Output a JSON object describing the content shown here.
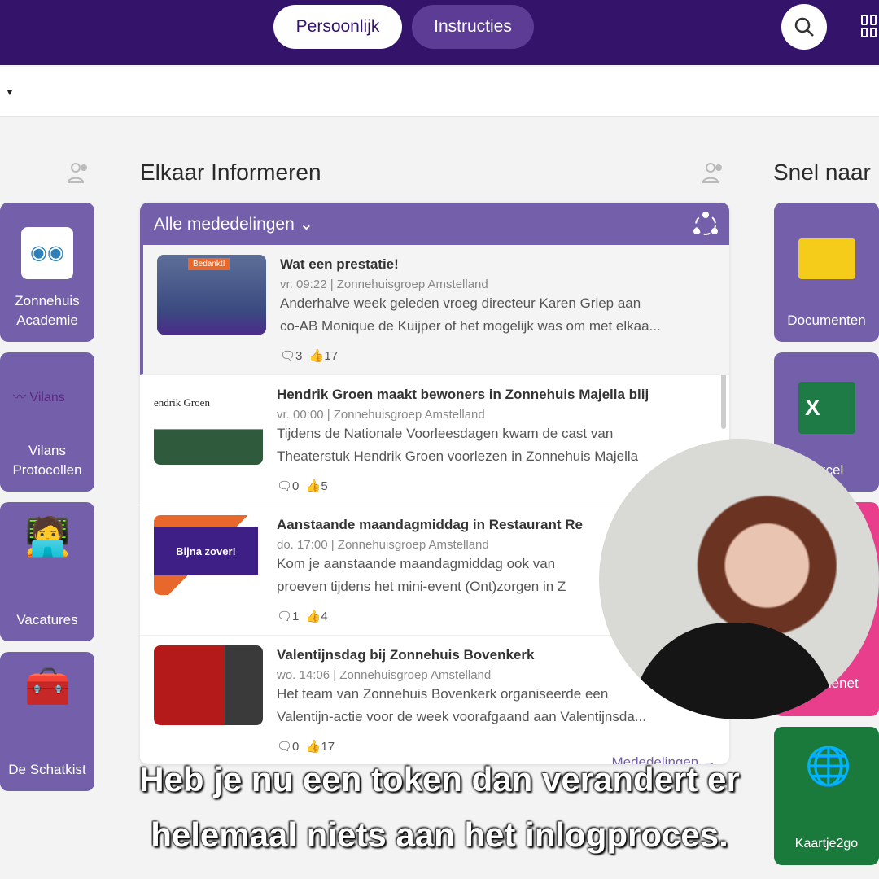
{
  "header": {
    "tabs": [
      {
        "label": "Persoonlijk",
        "active": true
      },
      {
        "label": "Instructies",
        "active": false
      }
    ],
    "accent": "#33146a"
  },
  "left_tiles": [
    {
      "label": "Zonnehuis Academie",
      "icon": "owl-icon"
    },
    {
      "label": "Vilans Protocollen",
      "icon": "vilans-logo"
    },
    {
      "label": "Vacatures",
      "icon": "desk-worker-icon"
    },
    {
      "label": "De Schatkist",
      "icon": "treasure-chest-icon"
    }
  ],
  "center": {
    "title": "Elkaar Informeren",
    "filter": "Alle mededelingen",
    "footer_link": "Mededelingen",
    "items": [
      {
        "title": "Wat een prestatie!",
        "meta": "vr. 09:22 | Zonnehuisgroep Amstelland",
        "desc1": "Anderhalve week geleden vroeg directeur Karen Griep aan",
        "desc2": "co-AB Monique de Kuijper of het mogelijk was om met elkaa...",
        "comments": "3",
        "likes": "17",
        "thumb": "Bedankt!"
      },
      {
        "title": "Hendrik Groen maakt bewoners in Zonnehuis Majella blij",
        "meta": "vr. 00:00 | Zonnehuisgroep Amstelland",
        "desc1": "Tijdens de Nationale Voorleesdagen kwam de cast van",
        "desc2": "Theaterstuk Hendrik Groen voorlezen in Zonnehuis Majella",
        "comments": "0",
        "likes": "5",
        "thumb": "endrik Groen"
      },
      {
        "title": "Aanstaande maandagmiddag in Restaurant Re",
        "meta": "do. 17:00 | Zonnehuisgroep Amstelland",
        "desc1": "Kom je aanstaande maandagmiddag ook van",
        "desc2": "proeven tijdens het mini-event (Ont)zorgen in Z",
        "comments": "1",
        "likes": "4",
        "thumb": "Bijna zover!"
      },
      {
        "title": "Valentijnsdag bij Zonnehuis Bovenkerk",
        "meta": "wo. 14:06 | Zonnehuisgroep Amstelland",
        "desc1": "Het team van Zonnehuis Bovenkerk organiseerde een",
        "desc2": "Valentijn-actie voor de week voorafgaand aan Valentijnsda...",
        "comments": "0",
        "likes": "17",
        "thumb": ""
      }
    ]
  },
  "right": {
    "title": "Snel naar",
    "tiles": [
      {
        "label": "Documenten"
      },
      {
        "label": "Excel"
      },
      {
        "label": "Familienet"
      },
      {
        "label": "Kaartje2go"
      }
    ]
  },
  "captions": [
    "Heb je nu een token dan verandert er",
    "helemaal niets aan het inlogproces."
  ]
}
